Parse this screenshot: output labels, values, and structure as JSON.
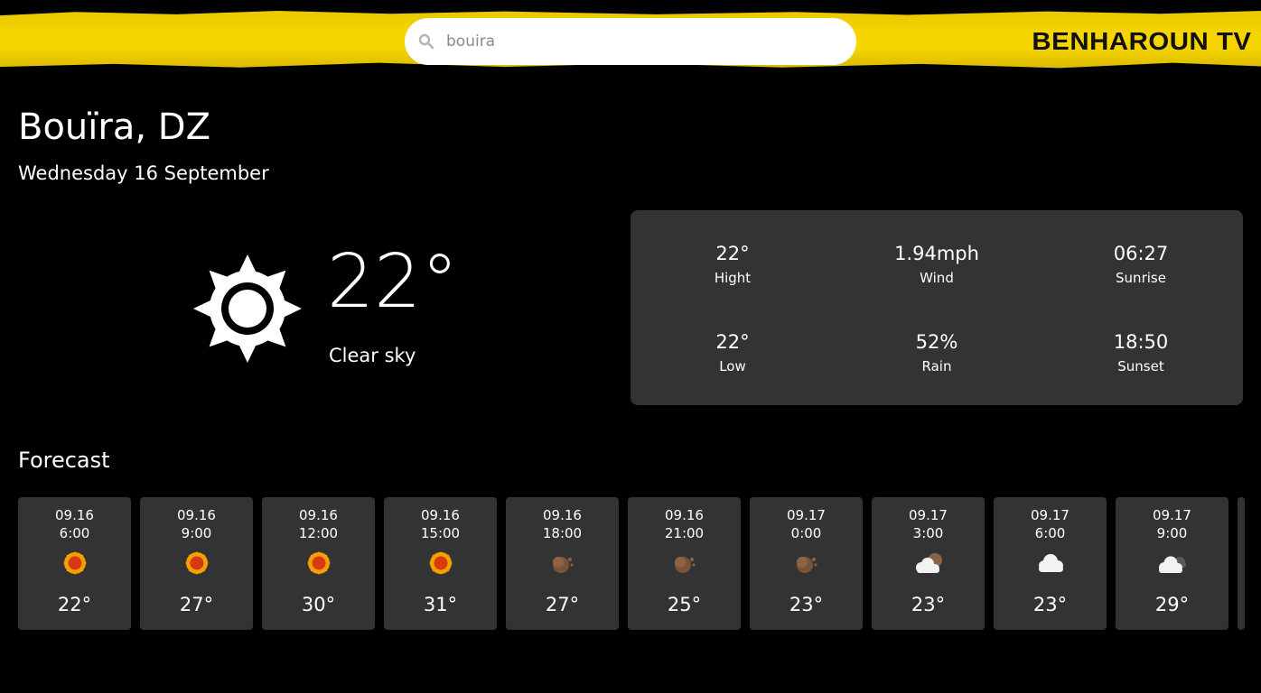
{
  "header": {
    "search_value": "bouira",
    "brand": "BENHAROUN TV",
    "accent_color": "#f6d500"
  },
  "location": {
    "city": "Bouïra, DZ",
    "date": "Wednesday 16 September"
  },
  "current": {
    "temp": "22°",
    "description": "Clear sky",
    "icon": "sun-icon"
  },
  "stats": {
    "high": {
      "value": "22°",
      "label": "Hight"
    },
    "wind": {
      "value": "1.94mph",
      "label": "Wind"
    },
    "sunrise": {
      "value": "06:27",
      "label": "Sunrise"
    },
    "low": {
      "value": "22°",
      "label": "Low"
    },
    "rain": {
      "value": "52%",
      "label": "Rain"
    },
    "sunset": {
      "value": "18:50",
      "label": "Sunset"
    }
  },
  "forecast": {
    "title": "Forecast",
    "items": [
      {
        "date": "09.16",
        "time": "6:00",
        "temp": "22°",
        "icon": "sun-icon"
      },
      {
        "date": "09.16",
        "time": "9:00",
        "temp": "27°",
        "icon": "sun-icon"
      },
      {
        "date": "09.16",
        "time": "12:00",
        "temp": "30°",
        "icon": "sun-icon"
      },
      {
        "date": "09.16",
        "time": "15:00",
        "temp": "31°",
        "icon": "sun-icon"
      },
      {
        "date": "09.16",
        "time": "18:00",
        "temp": "27°",
        "icon": "moon-icon"
      },
      {
        "date": "09.16",
        "time": "21:00",
        "temp": "25°",
        "icon": "moon-icon"
      },
      {
        "date": "09.17",
        "time": "0:00",
        "temp": "23°",
        "icon": "moon-icon"
      },
      {
        "date": "09.17",
        "time": "3:00",
        "temp": "23°",
        "icon": "cloud-moon-icon"
      },
      {
        "date": "09.17",
        "time": "6:00",
        "temp": "23°",
        "icon": "cloud-icon"
      },
      {
        "date": "09.17",
        "time": "9:00",
        "temp": "29°",
        "icon": "cloud-partial-icon"
      }
    ]
  }
}
